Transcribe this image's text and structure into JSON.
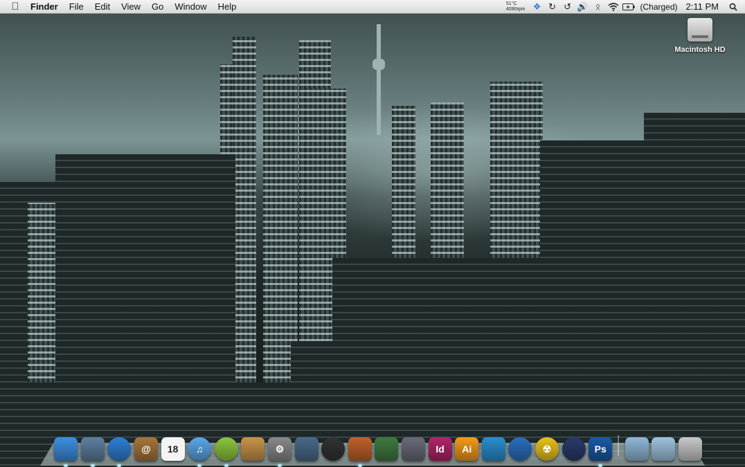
{
  "menubar": {
    "apple_icon": "apple-icon",
    "app_name": "Finder",
    "menus": [
      "File",
      "Edit",
      "View",
      "Go",
      "Window",
      "Help"
    ],
    "status": {
      "temperature": "51°C",
      "fan_speed": "4090rpm",
      "battery_text": "(Charged)",
      "clock": "2:11 PM"
    }
  },
  "desktop": {
    "icons": [
      {
        "label": "Macintosh HD",
        "icon": "hard-drive-icon"
      }
    ]
  },
  "dock": {
    "items": [
      {
        "name": "finder",
        "icon": "finder-icon",
        "text": "",
        "color": "#3d8fe0"
      },
      {
        "name": "mail-bird",
        "icon": "mail-stamp-icon",
        "text": "",
        "color": "#5f7fa0"
      },
      {
        "name": "safari",
        "icon": "safari-compass-icon",
        "text": "",
        "color": "#2f7fd6"
      },
      {
        "name": "address-book",
        "icon": "address-book-icon",
        "text": "@",
        "color": "#a8763d"
      },
      {
        "name": "ical",
        "icon": "calendar-icon",
        "text": "18",
        "color": "#f2f2f2"
      },
      {
        "name": "itunes",
        "icon": "itunes-icon",
        "text": "♫",
        "color": "#5aa8e8"
      },
      {
        "name": "lime-app",
        "icon": "lime-icon",
        "text": "",
        "color": "#8dc63f"
      },
      {
        "name": "iphoto",
        "icon": "photo-icon",
        "text": "",
        "color": "#c9944a"
      },
      {
        "name": "system-preferences",
        "icon": "gear-icon",
        "text": "⚙",
        "color": "#8a8a8a"
      },
      {
        "name": "dashboard",
        "icon": "dashboard-icon",
        "text": "",
        "color": "#4a6a8a"
      },
      {
        "name": "gauge-app",
        "icon": "gauge-icon",
        "text": "",
        "color": "#333333"
      },
      {
        "name": "keynote",
        "icon": "keynote-icon",
        "text": "",
        "color": "#c0622a"
      },
      {
        "name": "numbers",
        "icon": "chart-icon",
        "text": "",
        "color": "#3f7a3f"
      },
      {
        "name": "script-editor",
        "icon": "quill-icon",
        "text": "",
        "color": "#6a6a7a"
      },
      {
        "name": "indesign",
        "icon": "indesign-icon",
        "text": "Id",
        "color": "#b0256a"
      },
      {
        "name": "illustrator",
        "icon": "illustrator-icon",
        "text": "Ai",
        "color": "#f39a1b"
      },
      {
        "name": "messenger",
        "icon": "people-icon",
        "text": "",
        "color": "#2a8fd0"
      },
      {
        "name": "globe-app",
        "icon": "globe-icon",
        "text": "",
        "color": "#2a70c0"
      },
      {
        "name": "radiation-app",
        "icon": "radiation-icon",
        "text": "☢",
        "color": "#e9c21b"
      },
      {
        "name": "target-app",
        "icon": "target-icon",
        "text": "",
        "color": "#2a3a6a"
      },
      {
        "name": "photoshop",
        "icon": "photoshop-icon",
        "text": "Ps",
        "color": "#1a5aa6"
      },
      {
        "name": "applications-folder",
        "icon": "folder-icon",
        "text": "",
        "color": "#8fb8d8"
      },
      {
        "name": "documents-folder",
        "icon": "folder-icon",
        "text": "",
        "color": "#9fc3df"
      },
      {
        "name": "trash",
        "icon": "trash-icon",
        "text": "",
        "color": "#c8c8c8"
      }
    ]
  }
}
